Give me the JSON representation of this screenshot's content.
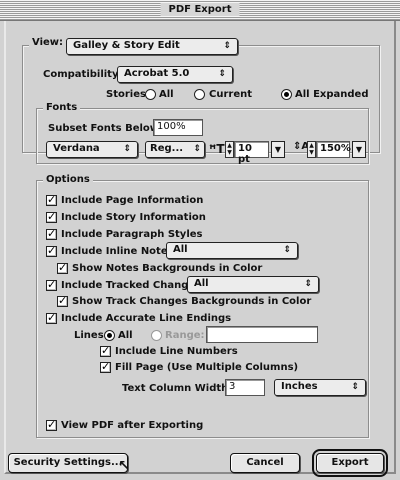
{
  "window": {
    "title": "PDF Export"
  },
  "view": {
    "label": "View:",
    "value": "Galley & Story Edit"
  },
  "compatibility": {
    "label": "Compatibility:",
    "value": "Acrobat 5.0"
  },
  "stories": {
    "label": "Stories:",
    "options": [
      "All",
      "Current",
      "All Expanded"
    ],
    "selected": "All Expanded"
  },
  "fonts": {
    "group_label": "Fonts",
    "subset_label": "Subset Fonts Below:",
    "subset_value": "100%",
    "font_family": "Verdana",
    "font_style": "Reg...",
    "font_size": "10 pt",
    "line_spacing": "150%"
  },
  "options": {
    "group_label": "Options",
    "include_page_info": "Include Page Information",
    "include_story_info": "Include Story Information",
    "include_paragraph_styles": "Include Paragraph Styles",
    "include_inline_notes": "Include Inline Notes:",
    "inline_notes_value": "All",
    "show_notes_backgrounds": "Show Notes Backgrounds in Color",
    "include_tracked_changes": "Include Tracked Changes:",
    "tracked_changes_value": "All",
    "show_track_changes_backgrounds": "Show Track Changes Backgrounds in Color",
    "include_line_endings": "Include Accurate Line Endings",
    "lines_label": "Lines:",
    "lines_all": "All",
    "lines_range": "Range:",
    "range_value": "",
    "include_line_numbers": "Include Line Numbers",
    "fill_page": "Fill Page (Use Multiple Columns)",
    "text_column_width_label": "Text Column Width:",
    "text_column_width_value": "3",
    "units_value": "Inches"
  },
  "view_pdf_after": "View PDF after Exporting",
  "buttons": {
    "security": "Security Settings...",
    "cancel": "Cancel",
    "export": "Export"
  }
}
